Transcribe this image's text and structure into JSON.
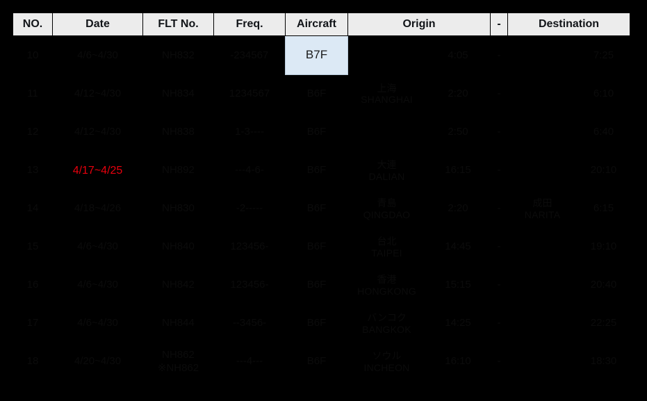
{
  "table": {
    "headers": {
      "no": "NO.",
      "date": "Date",
      "flt_no": "FLT No.",
      "freq": "Freq.",
      "aircraft": "Aircraft",
      "origin": "Origin",
      "dash": "-",
      "destination": "Destination"
    },
    "colors": {
      "header_bg": "#ececec",
      "header_text": "#111418",
      "body_bg": "#000000",
      "body_text": "#0b0b0b",
      "highlight_date": "#e8000d",
      "selected_cell_bg": "#dce9f5",
      "selected_cell_border": "#b9cbdc"
    },
    "rows": [
      {
        "no": "10",
        "date": "4/6~4/30",
        "flt_no": "NH832",
        "flt_no_sub": "",
        "freq": "-234567",
        "aircraft": "B7F",
        "aircraft_selected": true,
        "origin_cjk": "",
        "origin_rom": "",
        "dep_time": "4:05",
        "dash": "-",
        "dest_cjk": "",
        "dest_rom": "",
        "arr_time": "7:25",
        "date_red": false
      },
      {
        "no": "11",
        "date": "4/12~4/30",
        "flt_no": "NH834",
        "flt_no_sub": "",
        "freq": "1234567",
        "aircraft": "B6F",
        "aircraft_selected": false,
        "origin_cjk": "上海",
        "origin_rom": "SHANGHAI",
        "dep_time": "2:20",
        "dash": "-",
        "dest_cjk": "",
        "dest_rom": "",
        "arr_time": "6:10",
        "date_red": false
      },
      {
        "no": "12",
        "date": "4/12~4/30",
        "flt_no": "NH838",
        "flt_no_sub": "",
        "freq": "1-3----",
        "aircraft": "B6F",
        "aircraft_selected": false,
        "origin_cjk": "",
        "origin_rom": "",
        "dep_time": "2:50",
        "dash": "-",
        "dest_cjk": "",
        "dest_rom": "",
        "arr_time": "6:40",
        "date_red": false
      },
      {
        "no": "13",
        "date": "4/17~4/25",
        "flt_no": "NH892",
        "flt_no_sub": "",
        "freq": "---4-6-",
        "aircraft": "B6F",
        "aircraft_selected": false,
        "origin_cjk": "大連",
        "origin_rom": "DALIAN",
        "dep_time": "16:15",
        "dash": "-",
        "dest_cjk": "",
        "dest_rom": "",
        "arr_time": "20:10",
        "date_red": true
      },
      {
        "no": "14",
        "date": "4/18~4/26",
        "flt_no": "NH830",
        "flt_no_sub": "",
        "freq": "-2-----",
        "aircraft": "B6F",
        "aircraft_selected": false,
        "origin_cjk": "青島",
        "origin_rom": "QINGDAO",
        "dep_time": "2:20",
        "dash": "-",
        "dest_cjk": "成田",
        "dest_rom": "NARITA",
        "arr_time": "6:15",
        "date_red": false
      },
      {
        "no": "15",
        "date": "4/6~4/30",
        "flt_no": "NH840",
        "flt_no_sub": "",
        "freq": "123456-",
        "aircraft": "B6F",
        "aircraft_selected": false,
        "origin_cjk": "台北",
        "origin_rom": "TAIPEI",
        "dep_time": "14:45",
        "dash": "-",
        "dest_cjk": "",
        "dest_rom": "",
        "arr_time": "19:10",
        "date_red": false
      },
      {
        "no": "16",
        "date": "4/6~4/30",
        "flt_no": "NH842",
        "flt_no_sub": "",
        "freq": "123456-",
        "aircraft": "B6F",
        "aircraft_selected": false,
        "origin_cjk": "香港",
        "origin_rom": "HONGKONG",
        "dep_time": "15:15",
        "dash": "-",
        "dest_cjk": "",
        "dest_rom": "",
        "arr_time": "20:40",
        "date_red": false
      },
      {
        "no": "17",
        "date": "4/6~4/30",
        "flt_no": "NH844",
        "flt_no_sub": "",
        "freq": "--3456-",
        "aircraft": "B6F",
        "aircraft_selected": false,
        "origin_cjk": "バンコク",
        "origin_rom": "BANGKOK",
        "dep_time": "14:25",
        "dash": "-",
        "dest_cjk": "",
        "dest_rom": "",
        "arr_time": "22:25",
        "date_red": false
      },
      {
        "no": "18",
        "date": "4/20~4/30",
        "flt_no": "NH862",
        "flt_no_sub": "※NH862",
        "freq": "---4---",
        "aircraft": "B6F",
        "aircraft_selected": false,
        "origin_cjk": "ソウル",
        "origin_rom": "INCHEON",
        "dep_time": "16:10",
        "dash": "-",
        "dest_cjk": "",
        "dest_rom": "",
        "arr_time": "18:30",
        "date_red": false
      }
    ]
  }
}
